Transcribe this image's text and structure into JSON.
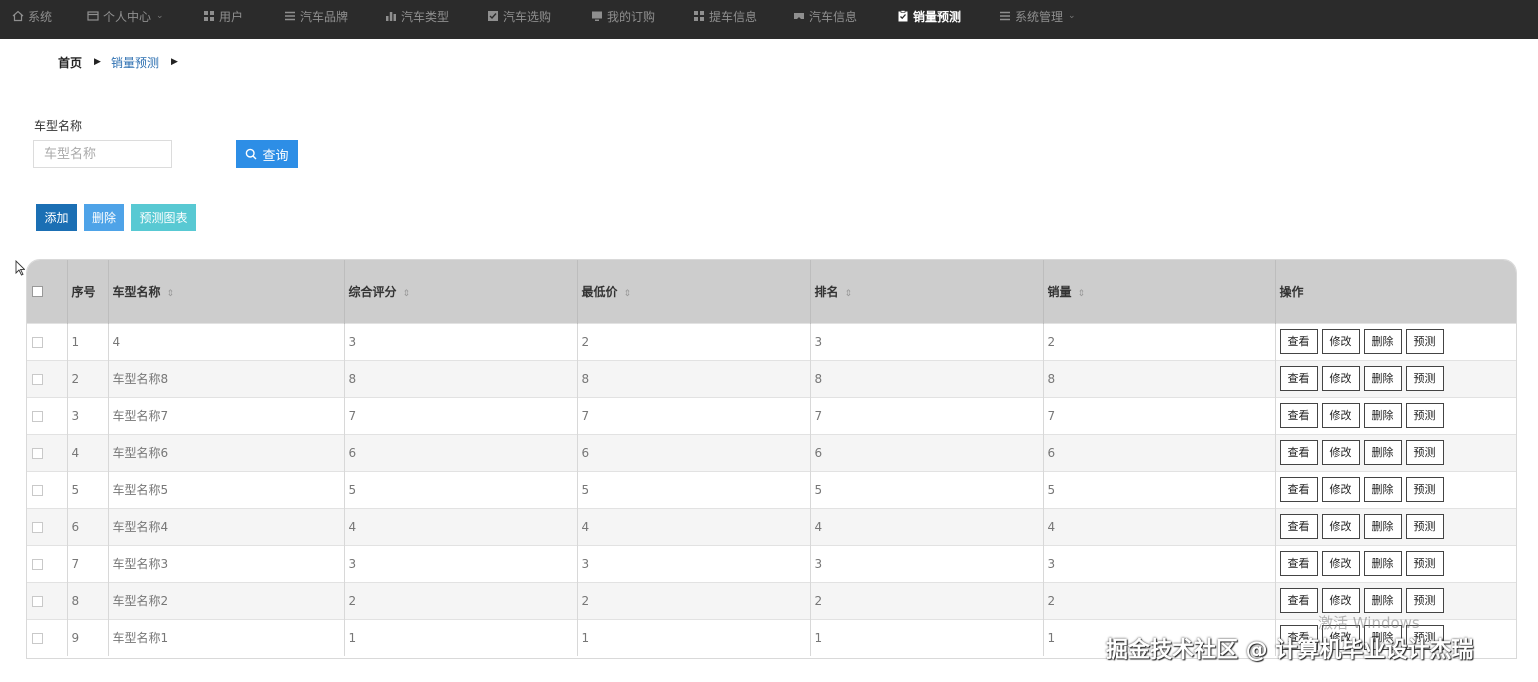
{
  "nav": {
    "items": [
      {
        "label": "系统",
        "icon": "home-icon"
      },
      {
        "label": "个人中心",
        "icon": "window-icon",
        "dropdown": true
      },
      {
        "label": "用户",
        "icon": "grid-icon"
      },
      {
        "label": "汽车品牌",
        "icon": "list-icon"
      },
      {
        "label": "汽车类型",
        "icon": "bar-chart-icon"
      },
      {
        "label": "汽车选购",
        "icon": "check-square-icon"
      },
      {
        "label": "我的订购",
        "icon": "monitor-icon"
      },
      {
        "label": "提车信息",
        "icon": "grid-icon"
      },
      {
        "label": "汽车信息",
        "icon": "car-icon"
      },
      {
        "label": "销量预测",
        "icon": "clipboard-icon",
        "active": true
      },
      {
        "label": "系统管理",
        "icon": "list-icon",
        "dropdown": true
      }
    ]
  },
  "breadcrumb": {
    "home": "首页",
    "current": "销量预测"
  },
  "search": {
    "label": "车型名称",
    "placeholder": "车型名称",
    "button": "查询"
  },
  "toolbar": {
    "add": "添加",
    "delete": "删除",
    "chart": "预测图表"
  },
  "table": {
    "headers": {
      "index": "序号",
      "name": "车型名称",
      "score": "综合评分",
      "price": "最低价",
      "rank": "排名",
      "sales": "销量",
      "ops": "操作"
    },
    "actions": {
      "view": "查看",
      "edit": "修改",
      "delete": "删除",
      "predict": "预测"
    },
    "rows": [
      {
        "index": "1",
        "name": "4",
        "score": "3",
        "price": "2",
        "rank": "3",
        "sales": "2"
      },
      {
        "index": "2",
        "name": "车型名称8",
        "score": "8",
        "price": "8",
        "rank": "8",
        "sales": "8"
      },
      {
        "index": "3",
        "name": "车型名称7",
        "score": "7",
        "price": "7",
        "rank": "7",
        "sales": "7"
      },
      {
        "index": "4",
        "name": "车型名称6",
        "score": "6",
        "price": "6",
        "rank": "6",
        "sales": "6"
      },
      {
        "index": "5",
        "name": "车型名称5",
        "score": "5",
        "price": "5",
        "rank": "5",
        "sales": "5"
      },
      {
        "index": "6",
        "name": "车型名称4",
        "score": "4",
        "price": "4",
        "rank": "4",
        "sales": "4"
      },
      {
        "index": "7",
        "name": "车型名称3",
        "score": "3",
        "price": "3",
        "rank": "3",
        "sales": "3"
      },
      {
        "index": "8",
        "name": "车型名称2",
        "score": "2",
        "price": "2",
        "rank": "2",
        "sales": "2"
      },
      {
        "index": "9",
        "name": "车型名称1",
        "score": "1",
        "price": "1",
        "rank": "1",
        "sales": "1"
      }
    ]
  },
  "overlay": {
    "watermark": "掘金技术社区 @ 计算机毕业设计杰瑞",
    "windows_activate": "激活 Windows"
  }
}
